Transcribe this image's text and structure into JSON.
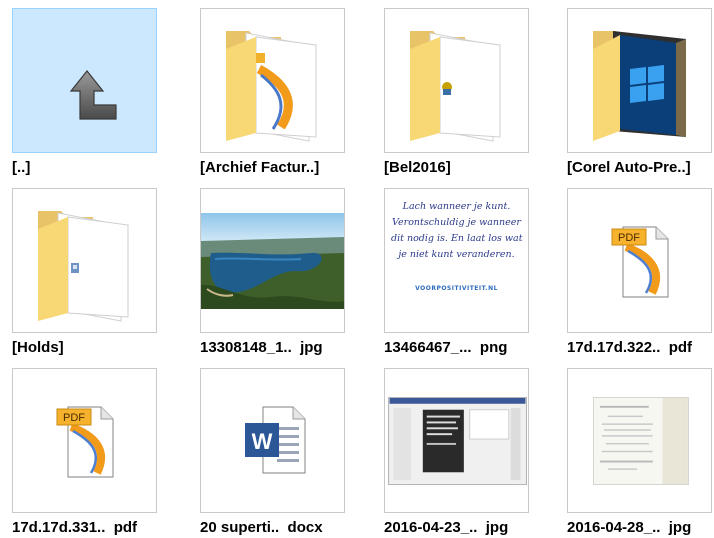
{
  "items": [
    {
      "label": "[..]",
      "kind": "parent-folder",
      "selected": true
    },
    {
      "label": "[Archief Factur..]",
      "kind": "folder-pdf"
    },
    {
      "label": "[Bel2016]",
      "kind": "folder-doc"
    },
    {
      "label": "[Corel Auto-Pre..]",
      "kind": "folder-windows"
    },
    {
      "label": "[Holds]",
      "kind": "folder-plain"
    },
    {
      "label": "13308148_1..  jpg",
      "kind": "photo-lake"
    },
    {
      "label": "13466467_...  png",
      "kind": "quote-image"
    },
    {
      "label": "17d.17d.322..  pdf",
      "kind": "pdf"
    },
    {
      "label": "17d.17d.331..  pdf",
      "kind": "pdf"
    },
    {
      "label": "20 superti..  docx",
      "kind": "word"
    },
    {
      "label": "2016-04-23_..  jpg",
      "kind": "screenshot"
    },
    {
      "label": "2016-04-28_..  jpg",
      "kind": "document-scan"
    }
  ],
  "pdf_badge": "PDF",
  "word_badge": "W",
  "quote": {
    "lines": [
      "Lach wanneer je kunt.",
      "Verontschuldig je wanneer",
      "dit nodig is. En laat los wat",
      "je niet kunt veranderen."
    ],
    "logo": "VOORPOSITIVITEIT.NL"
  },
  "colors": {
    "selection_bg": "#cce8ff",
    "selection_border": "#99d1ff",
    "folder_back": "#e8c368",
    "folder_front": "#f8d775",
    "pdf_orange": "#f29a1a",
    "word_blue": "#2b5797"
  }
}
